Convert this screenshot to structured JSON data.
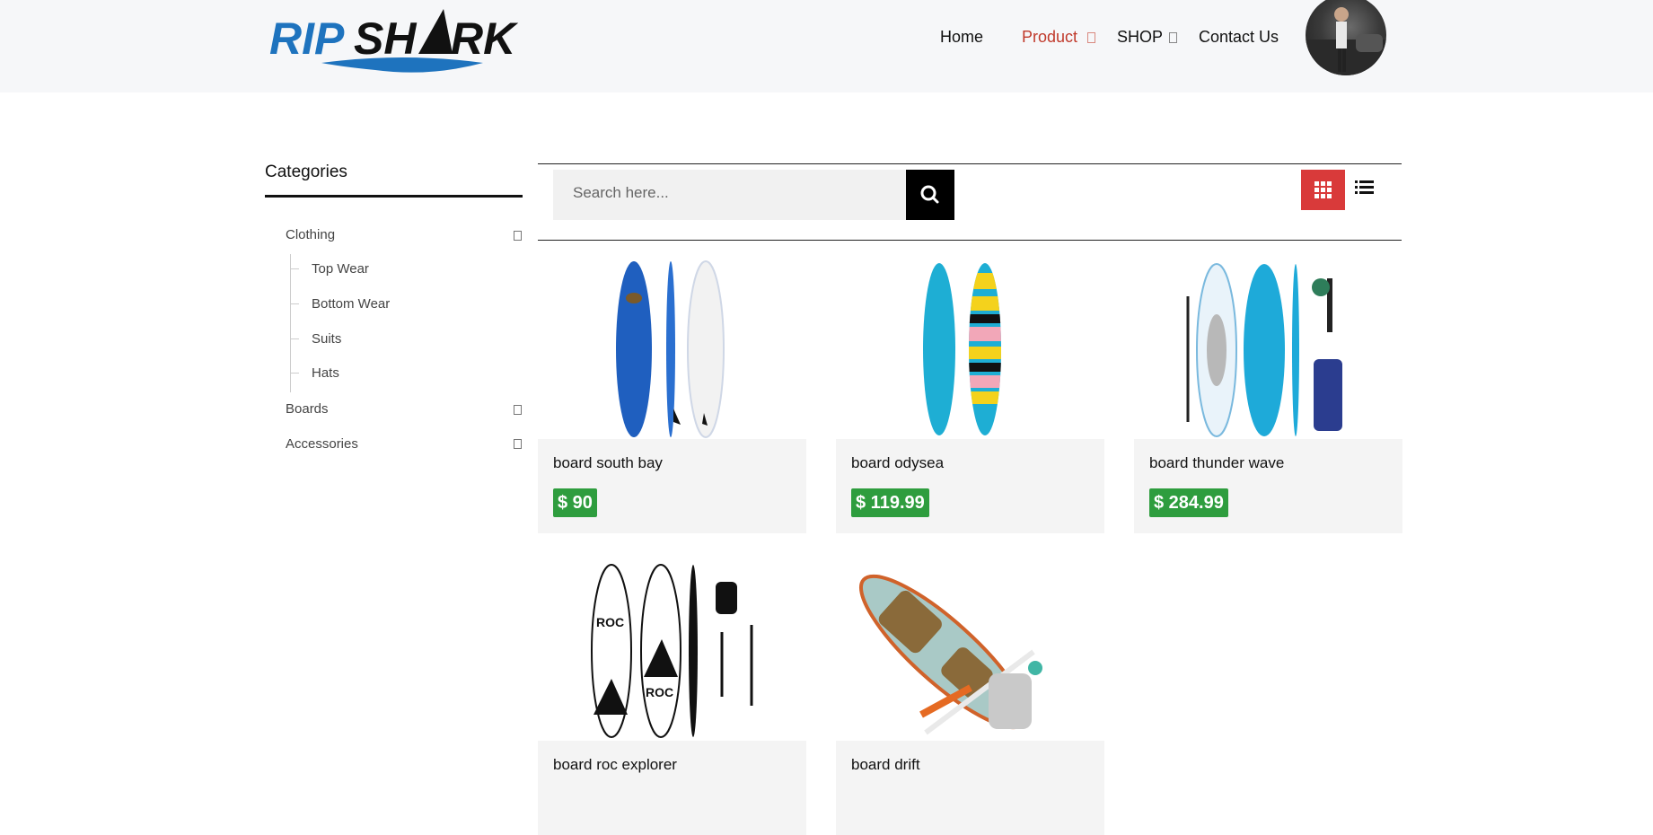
{
  "header": {
    "logo_text": "RIPSHARK",
    "nav": {
      "home": "Home",
      "product": "Product",
      "shop": "SHOP",
      "contact": "Contact Us"
    }
  },
  "sidebar": {
    "title": "Categories",
    "items": [
      {
        "label": "Clothing"
      },
      {
        "label": "Top Wear"
      },
      {
        "label": "Bottom Wear"
      },
      {
        "label": "Suits"
      },
      {
        "label": "Hats"
      },
      {
        "label": "Boards"
      },
      {
        "label": "Accessories"
      }
    ]
  },
  "search": {
    "placeholder": "Search here..."
  },
  "products": [
    {
      "name": "board south bay",
      "price": "$ 90"
    },
    {
      "name": "board odysea",
      "price": "$ 119.99"
    },
    {
      "name": "board thunder wave",
      "price": "$ 284.99"
    },
    {
      "name": "board roc explorer",
      "price": ""
    },
    {
      "name": "board drift",
      "price": ""
    }
  ],
  "colors": {
    "accent": "#d93a3a",
    "active_nav": "#c0392b",
    "price_badge": "#2e9d3e",
    "header_bg": "#f6f7f9"
  },
  "icons": [
    "search-icon",
    "grid-view-icon",
    "list-view-icon",
    "caret-icon",
    "avatar"
  ]
}
